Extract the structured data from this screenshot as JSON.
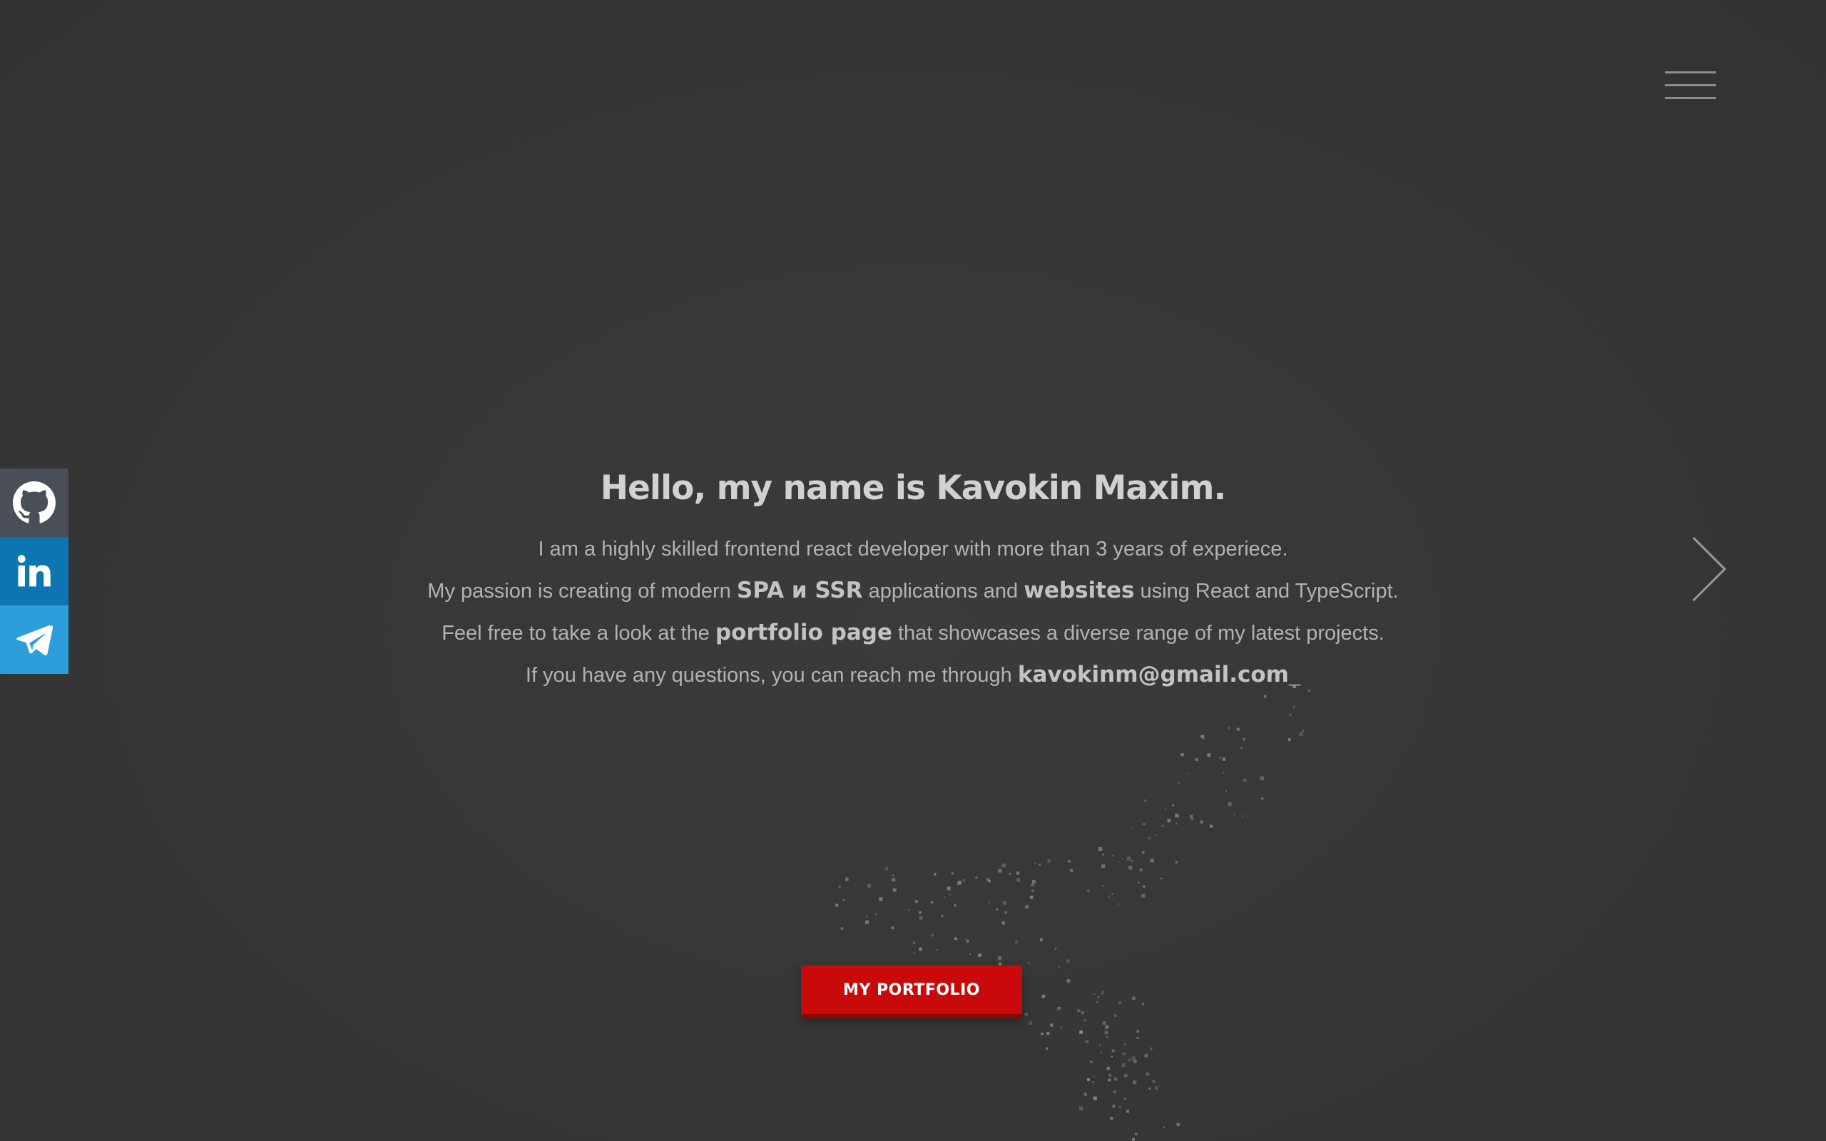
{
  "header": {
    "menu_icon": "hamburger-menu-icon"
  },
  "social": [
    {
      "name": "GitHub",
      "icon": "github-icon",
      "color": "#4a4f57"
    },
    {
      "name": "LinkedIn",
      "icon": "linkedin-icon",
      "color": "#0d76b2"
    },
    {
      "name": "Telegram",
      "icon": "telegram-icon",
      "color": "#2c9fdb"
    }
  ],
  "hero": {
    "title": "Hello, my name is Kavokin Maxim.",
    "line1": "I am a highly skilled frontend react developer with more than 3 years of experiece.",
    "line2": {
      "before": "My passion is creating of modern ",
      "em1": "SPA и SSR",
      "middle": " applications and ",
      "em2": "websites",
      "after": " using React and TypeScript."
    },
    "line3": {
      "before": "Feel free to take a look at the ",
      "em": "portfolio page",
      "after": " that showcases a diverse range of my latest projects."
    },
    "line4": {
      "before": "If you have any questions, you can reach me through ",
      "email": "kavokinm@gmail.com",
      "cursor": "_"
    }
  },
  "cta": {
    "label": "MY PORTFOLIO"
  },
  "navigation": {
    "next_icon": "chevron-right-icon"
  },
  "colors": {
    "background": "#363636",
    "accent": "#c80a0a",
    "text": "#b2b2b2"
  }
}
